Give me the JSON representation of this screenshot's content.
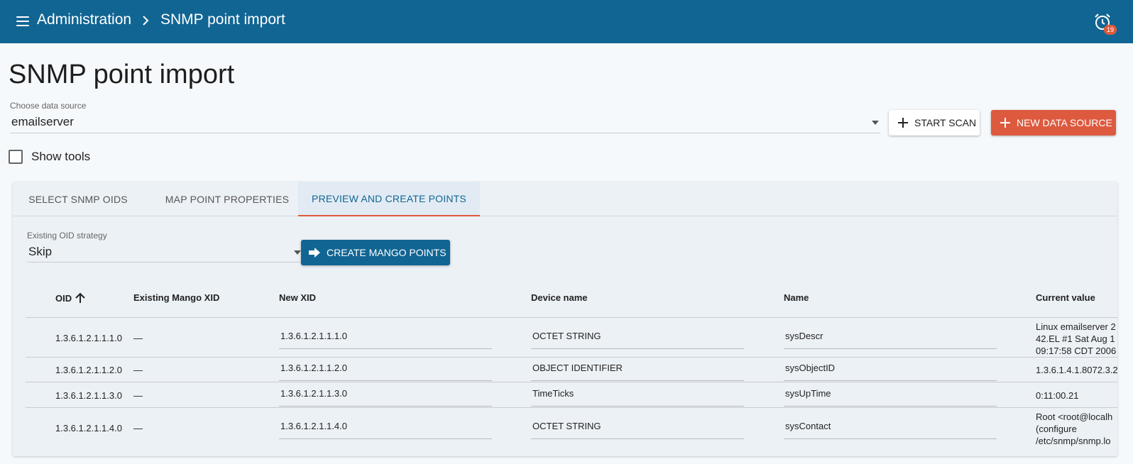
{
  "header": {
    "section": "Administration",
    "page": "SNMP point import",
    "alarm_count": "19",
    "bar_color": "#116593"
  },
  "page_title": "SNMP point import",
  "data_source": {
    "label": "Choose data source",
    "value": "emailserver"
  },
  "buttons": {
    "start_scan": "START SCAN",
    "new_data_source": "NEW DATA SOURCE",
    "create_points": "CREATE MANGO POINTS"
  },
  "show_tools": {
    "label": "Show tools",
    "checked": false
  },
  "tabs": [
    {
      "label": "SELECT SNMP OIDS",
      "active": false
    },
    {
      "label": "MAP POINT PROPERTIES",
      "active": false
    },
    {
      "label": "PREVIEW AND CREATE POINTS",
      "active": true
    }
  ],
  "strategy": {
    "label": "Existing OID strategy",
    "value": "Skip"
  },
  "table": {
    "columns": [
      "OID",
      "Existing Mango XID",
      "New XID",
      "Device name",
      "Name",
      "Current value"
    ],
    "sort_column": "OID",
    "sort_direction": "ascending",
    "rows": [
      {
        "oid": "1.3.6.1.2.1.1.1.0",
        "existing_xid": "—",
        "new_xid": "1.3.6.1.2.1.1.1.0",
        "device_name": "OCTET STRING",
        "name": "sysDescr",
        "current_value": [
          "Linux emailserver 2",
          "42.EL #1 Sat Aug 1",
          "09:17:58 CDT 2006"
        ]
      },
      {
        "oid": "1.3.6.1.2.1.1.2.0",
        "existing_xid": "—",
        "new_xid": "1.3.6.1.2.1.1.2.0",
        "device_name": "OBJECT IDENTIFIER",
        "name": "sysObjectID",
        "current_value": [
          "1.3.6.1.4.1.8072.3.2."
        ]
      },
      {
        "oid": "1.3.6.1.2.1.1.3.0",
        "existing_xid": "—",
        "new_xid": "1.3.6.1.2.1.1.3.0",
        "device_name": "TimeTicks",
        "name": "sysUpTime",
        "current_value": [
          "0:11:00.21"
        ]
      },
      {
        "oid": "1.3.6.1.2.1.1.4.0",
        "existing_xid": "—",
        "new_xid": "1.3.6.1.2.1.1.4.0",
        "device_name": "OCTET STRING",
        "name": "sysContact",
        "current_value": [
          "Root <root@localh",
          "(configure",
          "/etc/snmp/snmp.lo"
        ]
      }
    ]
  },
  "icons": {
    "menu": "menu-icon",
    "breadcrumb_separator": "chevron-right-icon",
    "alarm": "alarm-clock-icon",
    "dropdown": "caret-down-icon",
    "add": "plus-icon",
    "create": "arrow-right-icon",
    "sort": "arrow-up-icon"
  }
}
